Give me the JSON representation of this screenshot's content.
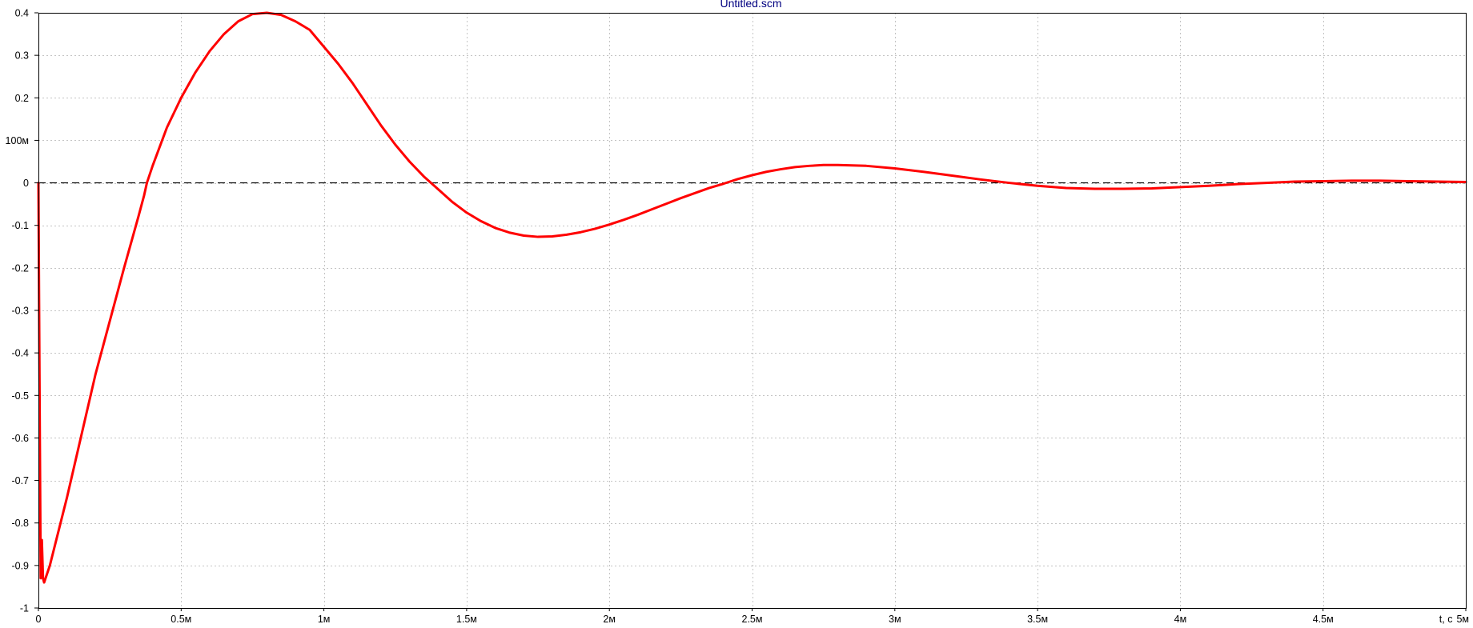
{
  "window": {
    "title": "Untitled.scm"
  },
  "chart_data": {
    "type": "line",
    "title": "Untitled.scm",
    "xlabel": "t, c",
    "ylabel": "",
    "xlim": [
      0,
      0.005
    ],
    "ylim": [
      -1,
      0.4
    ],
    "grid": true,
    "x_ticks": [
      {
        "value": 0,
        "label": "0"
      },
      {
        "value": 0.0005,
        "label": "0.5м"
      },
      {
        "value": 0.001,
        "label": "1м"
      },
      {
        "value": 0.0015,
        "label": "1.5м"
      },
      {
        "value": 0.002,
        "label": "2м"
      },
      {
        "value": 0.0025,
        "label": "2.5м"
      },
      {
        "value": 0.003,
        "label": "3м"
      },
      {
        "value": 0.0035,
        "label": "3.5м"
      },
      {
        "value": 0.004,
        "label": "4м"
      },
      {
        "value": 0.0045,
        "label": "4.5м"
      },
      {
        "value": 0.005,
        "label": "5м"
      }
    ],
    "y_ticks": [
      {
        "value": 0.4,
        "label": "0.4"
      },
      {
        "value": 0.3,
        "label": "0.3"
      },
      {
        "value": 0.2,
        "label": "0.2"
      },
      {
        "value": 0.1,
        "label": "100м"
      },
      {
        "value": 0,
        "label": "0"
      },
      {
        "value": -0.1,
        "label": "-0.1"
      },
      {
        "value": -0.2,
        "label": "-0.2"
      },
      {
        "value": -0.3,
        "label": "-0.3"
      },
      {
        "value": -0.4,
        "label": "-0.4"
      },
      {
        "value": -0.5,
        "label": "-0.5"
      },
      {
        "value": -0.6,
        "label": "-0.6"
      },
      {
        "value": -0.7,
        "label": "-0.7"
      },
      {
        "value": -0.8,
        "label": "-0.8"
      },
      {
        "value": -0.9,
        "label": "-0.9"
      },
      {
        "value": -1,
        "label": "-1"
      }
    ],
    "zero_reference": {
      "y": 0,
      "style": "dashed",
      "color": "#000000"
    },
    "series": [
      {
        "color": "#ff0000",
        "points": [
          [
            0,
            0
          ],
          [
            5e-06,
            -0.6
          ],
          [
            8e-06,
            -0.93
          ],
          [
            1.2e-05,
            -0.84
          ],
          [
            1.6e-05,
            -0.93
          ],
          [
            2e-05,
            -0.94
          ],
          [
            4e-05,
            -0.9
          ],
          [
            0.0001,
            -0.74
          ],
          [
            0.0002,
            -0.45
          ],
          [
            0.0003,
            -0.2
          ],
          [
            0.00035,
            -0.08
          ],
          [
            0.00037,
            -0.03
          ],
          [
            0.00038,
            0
          ],
          [
            0.0004,
            0.04
          ],
          [
            0.00045,
            0.13
          ],
          [
            0.0005,
            0.2
          ],
          [
            0.00055,
            0.26
          ],
          [
            0.0006,
            0.31
          ],
          [
            0.00065,
            0.35
          ],
          [
            0.0007,
            0.38
          ],
          [
            0.00075,
            0.397
          ],
          [
            0.0008,
            0.4
          ],
          [
            0.00085,
            0.395
          ],
          [
            0.0009,
            0.38
          ],
          [
            0.00095,
            0.36
          ],
          [
            0.001,
            0.32
          ],
          [
            0.00105,
            0.28
          ],
          [
            0.0011,
            0.235
          ],
          [
            0.00115,
            0.185
          ],
          [
            0.0012,
            0.135
          ],
          [
            0.00125,
            0.09
          ],
          [
            0.0013,
            0.05
          ],
          [
            0.00135,
            0.015
          ],
          [
            0.0014,
            -0.015
          ],
          [
            0.00145,
            -0.045
          ],
          [
            0.0015,
            -0.07
          ],
          [
            0.00155,
            -0.09
          ],
          [
            0.0016,
            -0.106
          ],
          [
            0.00165,
            -0.117
          ],
          [
            0.0017,
            -0.124
          ],
          [
            0.00175,
            -0.127
          ],
          [
            0.0018,
            -0.126
          ],
          [
            0.00185,
            -0.122
          ],
          [
            0.0019,
            -0.116
          ],
          [
            0.00195,
            -0.108
          ],
          [
            0.002,
            -0.098
          ],
          [
            0.00205,
            -0.087
          ],
          [
            0.0021,
            -0.075
          ],
          [
            0.00215,
            -0.062
          ],
          [
            0.0022,
            -0.049
          ],
          [
            0.00225,
            -0.036
          ],
          [
            0.0023,
            -0.024
          ],
          [
            0.00235,
            -0.012
          ],
          [
            0.0024,
            -0.002
          ],
          [
            0.00245,
            0.009
          ],
          [
            0.0025,
            0.018
          ],
          [
            0.00255,
            0.026
          ],
          [
            0.0026,
            0.032
          ],
          [
            0.00265,
            0.037
          ],
          [
            0.0027,
            0.04
          ],
          [
            0.00275,
            0.042
          ],
          [
            0.0028,
            0.042
          ],
          [
            0.0029,
            0.04
          ],
          [
            0.003,
            0.034
          ],
          [
            0.0031,
            0.026
          ],
          [
            0.0032,
            0.017
          ],
          [
            0.0033,
            0.008
          ],
          [
            0.0034,
            0
          ],
          [
            0.0035,
            -0.007
          ],
          [
            0.0036,
            -0.012
          ],
          [
            0.0037,
            -0.014
          ],
          [
            0.0038,
            -0.014
          ],
          [
            0.0039,
            -0.013
          ],
          [
            0.004,
            -0.01
          ],
          [
            0.0041,
            -0.007
          ],
          [
            0.0042,
            -0.003
          ],
          [
            0.0043,
            0
          ],
          [
            0.0044,
            0.003
          ],
          [
            0.0045,
            0.004
          ],
          [
            0.0046,
            0.005
          ],
          [
            0.0047,
            0.005
          ],
          [
            0.0048,
            0.004
          ],
          [
            0.0049,
            0.003
          ],
          [
            0.005,
            0.002
          ]
        ]
      }
    ]
  }
}
